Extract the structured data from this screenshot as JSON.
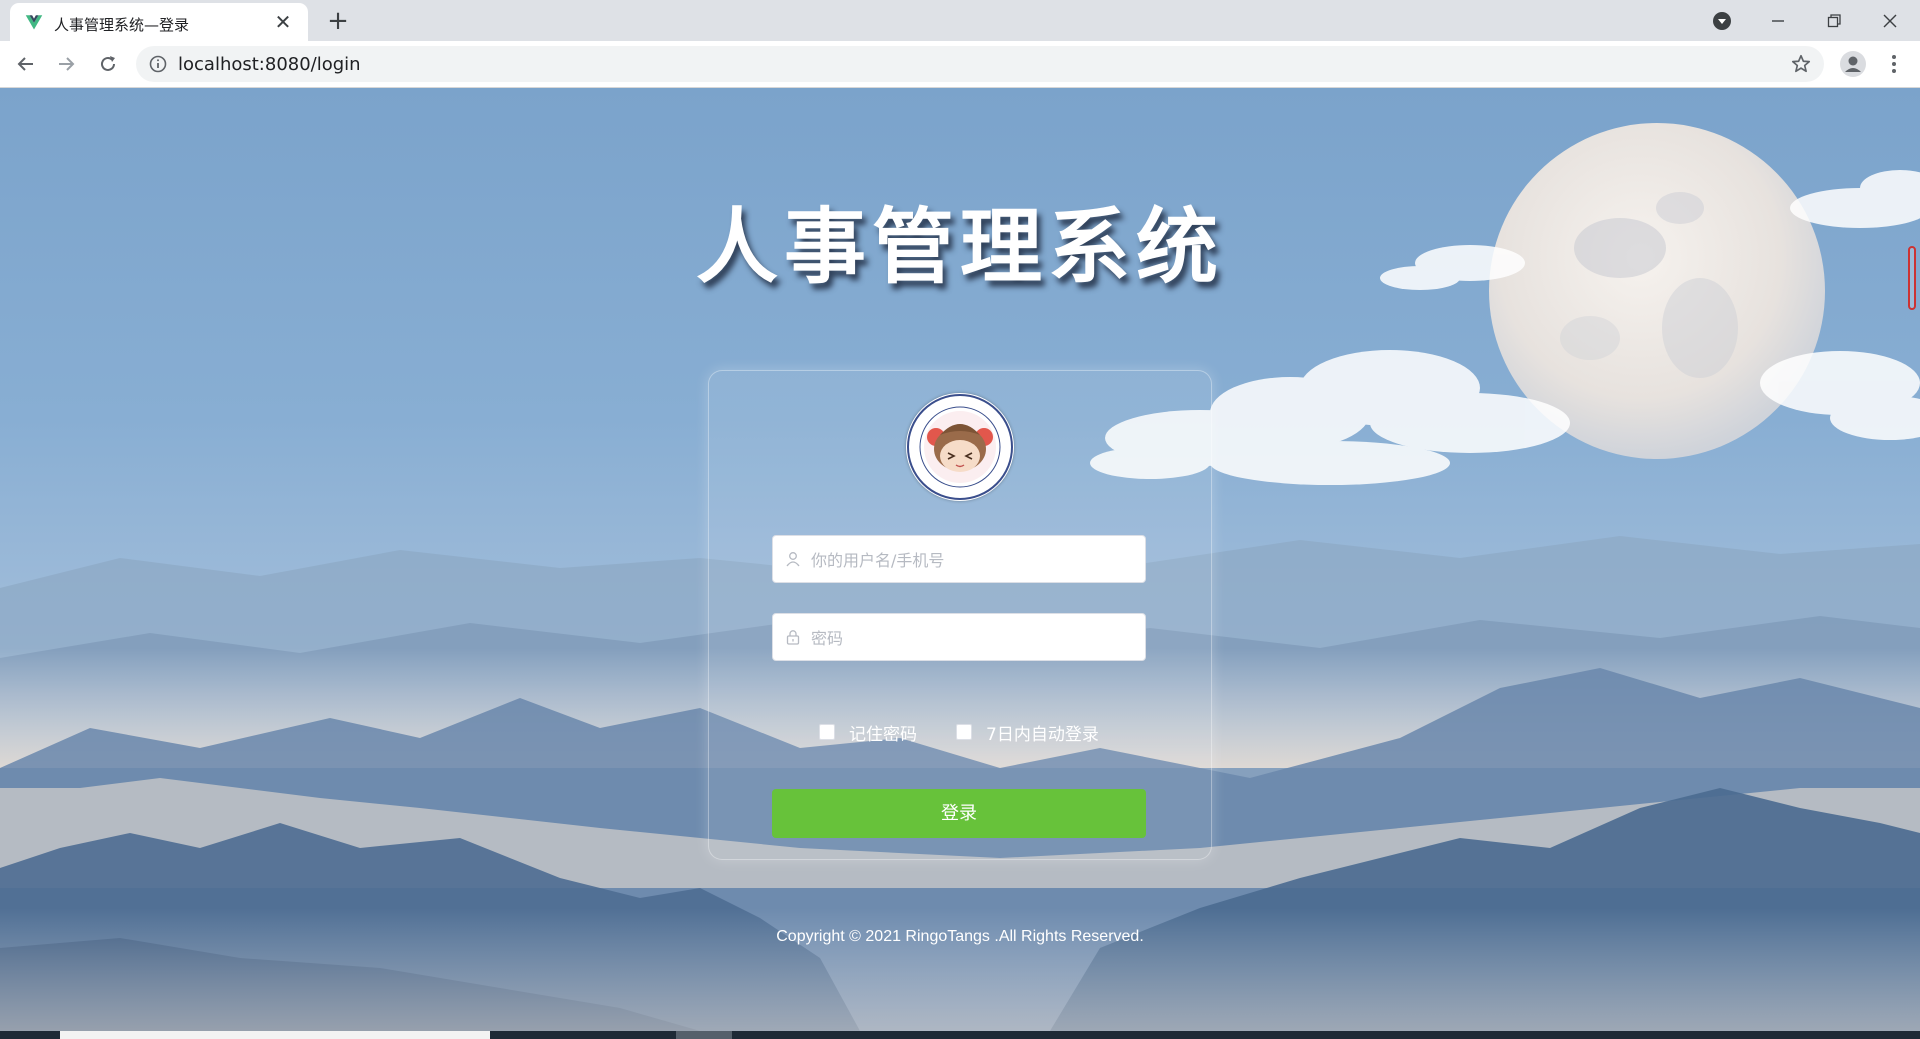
{
  "browser": {
    "tab_title": "人事管理系统—登录",
    "close_glyph": "✕",
    "new_tab_glyph": "+",
    "url": "localhost:8080/login",
    "icons": [
      "vue-favicon",
      "back-icon",
      "forward-icon",
      "reload-icon",
      "info-icon",
      "star-icon",
      "profile-icon",
      "menu-icon",
      "media-icon",
      "minimize-icon",
      "restore-icon",
      "close-window-icon"
    ]
  },
  "login": {
    "system_title": "人事管理系统",
    "username_placeholder": "你的用户名/手机号",
    "password_placeholder": "密码",
    "remember_label": "记住密码",
    "auto_login_label": "7日内自动登录",
    "submit_label": "登录",
    "copyright": "Copyright © 2021 RingoTangs .All Rights Reserved."
  },
  "colors": {
    "button": "#67c23a",
    "sky": "#7ba3cb",
    "text": "#ffffff"
  }
}
